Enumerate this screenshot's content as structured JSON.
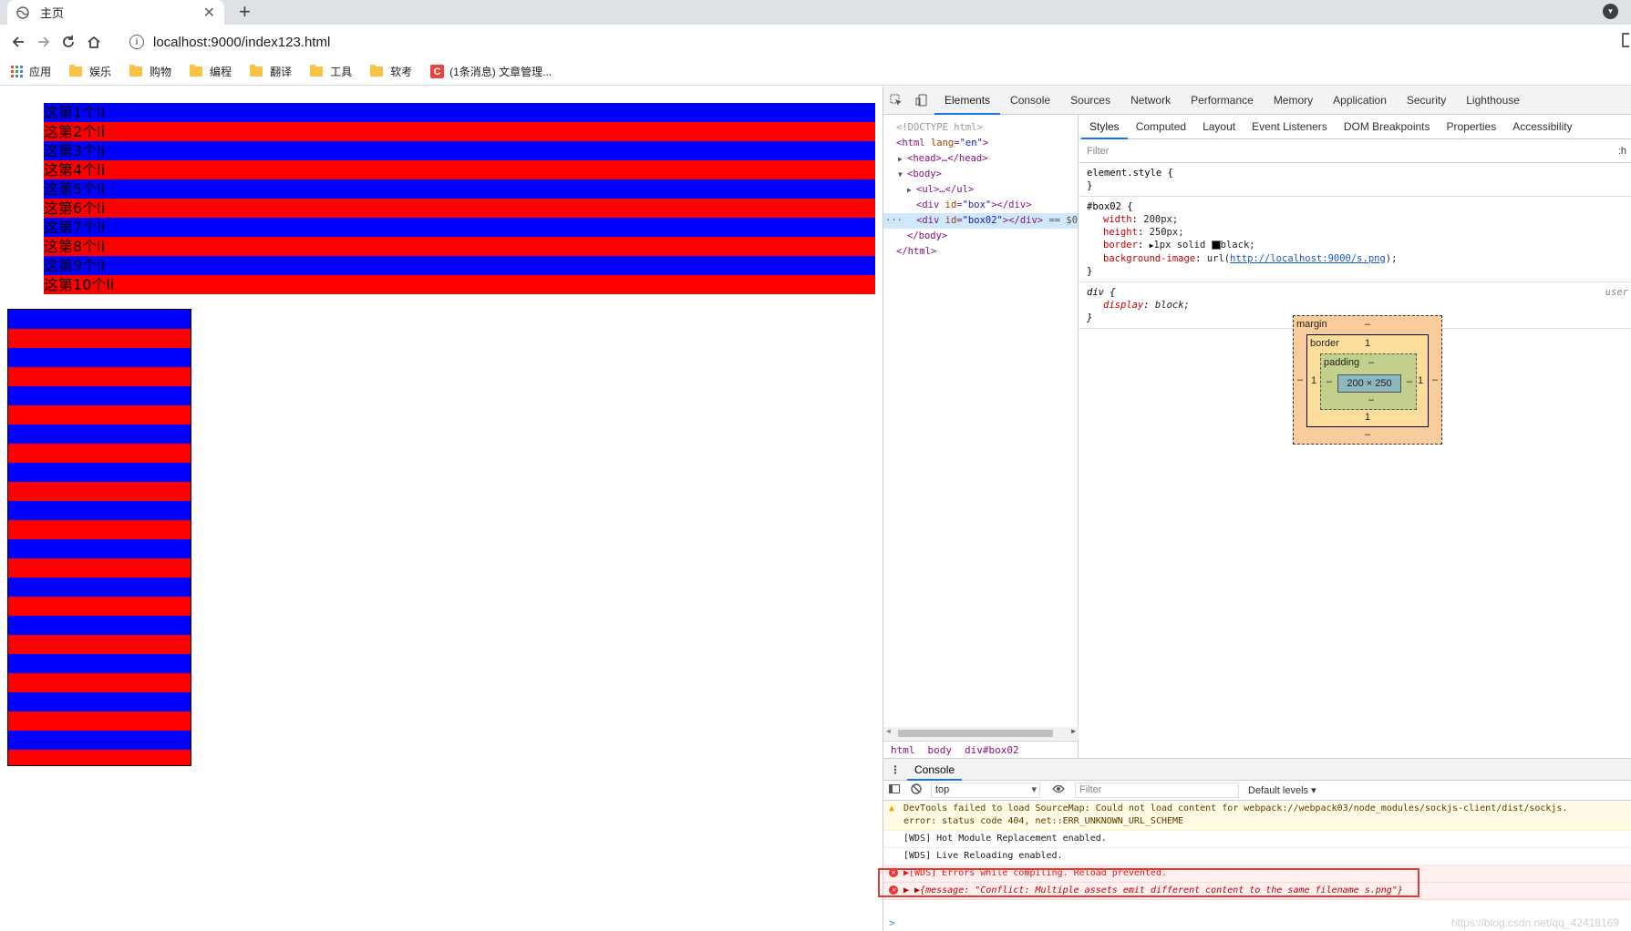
{
  "browser": {
    "tab_title": "主页",
    "new_tab_label": "+",
    "address": "localhost:9000/index123.html",
    "bookmarks": [
      {
        "label": "应用",
        "icon": "apps-grid-icon"
      },
      {
        "label": "娱乐",
        "icon": "folder-icon"
      },
      {
        "label": "购物",
        "icon": "folder-icon"
      },
      {
        "label": "编程",
        "icon": "folder-icon"
      },
      {
        "label": "翻译",
        "icon": "folder-icon"
      },
      {
        "label": "工具",
        "icon": "folder-icon"
      },
      {
        "label": "软考",
        "icon": "folder-icon"
      },
      {
        "label": "(1条消息) 文章管理...",
        "icon": "csdn-icon"
      }
    ]
  },
  "page": {
    "list_items": [
      "这第1个li",
      "这第2个li",
      "这第3个li",
      "这第4个li",
      "这第5个li",
      "这第6个li",
      "这第7个li",
      "这第8个li",
      "这第9个li",
      "这第10个li"
    ],
    "stripe_colors": [
      "#0000ff",
      "#ff0000"
    ],
    "box_stripe_count": 24
  },
  "devtools": {
    "tabs": [
      "Elements",
      "Console",
      "Sources",
      "Network",
      "Performance",
      "Memory",
      "Application",
      "Security",
      "Lighthouse"
    ],
    "active_tab": "Elements",
    "dom": {
      "doctype": "<!DOCTYPE html>",
      "html_open": "<html",
      "html_attr": "lang",
      "html_val": "\"en\"",
      "head": "<head>…</head>",
      "body_open": "<body>",
      "ul": "<ul>…</ul>",
      "div_tag": "<div",
      "id_attr": "id",
      "box_val": "\"box\"",
      "box02_val": "\"box02\"",
      "div_close": "></div>",
      "sel_marker": "== $0",
      "body_close": "</body>",
      "html_close": "</html>",
      "dots": "···"
    },
    "breadcrumbs": [
      "html",
      "body",
      "div#box02"
    ],
    "style_tabs": [
      "Styles",
      "Computed",
      "Layout",
      "Event Listeners",
      "DOM Breakpoints",
      "Properties",
      "Accessibility"
    ],
    "filter_placeholder": "Filter",
    "hov_label": ":h",
    "rules": {
      "element_style": "element.style {",
      "close": "}",
      "box02_selector": "#box02 {",
      "width_prop": "width",
      "width_val": "200px;",
      "height_prop": "height",
      "height_val": "250px;",
      "border_prop": "border",
      "border_val_pre": "1px solid",
      "border_val_post": "black;",
      "bg_prop": "background-image",
      "bg_val_pre": "url(",
      "bg_url": "http://localhost:9000/s.png",
      "bg_val_post": ");",
      "div_selector": "div {",
      "div_source": "user",
      "display_prop": "display",
      "display_val": "block;"
    },
    "box_model": {
      "margin_label": "margin",
      "margin_val": "–",
      "border_label": "border",
      "border_top": "1",
      "border_bottom": "1",
      "border_left": "1",
      "border_right": "1",
      "padding_label": "padding",
      "padding_val": "–",
      "content": "200 × 250",
      "dash": "–"
    },
    "console": {
      "tab": "Console",
      "context": "top",
      "filter_placeholder": "Filter",
      "levels": "Default levels ▾",
      "messages": [
        {
          "type": "warn",
          "text": "DevTools failed to load SourceMap: Could not load content for webpack://webpack03/node_modules/sockjs-client/dist/sockjs.",
          "text2": "error: status code 404, net::ERR_UNKNOWN_URL_SCHEME"
        },
        {
          "type": "info",
          "text": "[WDS] Hot Module Replacement enabled."
        },
        {
          "type": "info",
          "text": "[WDS] Live Reloading enabled."
        },
        {
          "type": "error",
          "text": "▶[WDS] Errors while compiling. Reload prevented."
        },
        {
          "type": "error",
          "text": "▶ ▶{message: \"Conflict: Multiple assets emit different content to the same filename s.png\"}"
        }
      ],
      "prompt": ">",
      "watermark": "https://blog.csdn.net/qq_42418169"
    }
  }
}
